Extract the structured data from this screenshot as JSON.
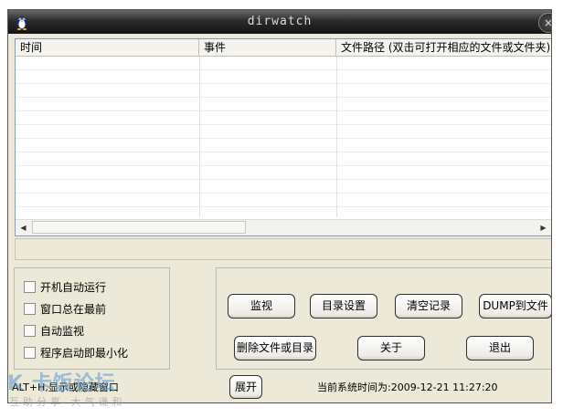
{
  "window": {
    "title": "dirwatch",
    "close_glyph": "×"
  },
  "list": {
    "columns": [
      "时间",
      "事件",
      "文件路径 (双击可打开相应的文件或文件夹)"
    ]
  },
  "options": {
    "auto_start": "开机自动运行",
    "always_on_top": "窗口总在最前",
    "auto_monitor": "自动监视",
    "minimize_on_start": "程序启动即最小化"
  },
  "buttons": {
    "monitor": "监视",
    "dir_settings": "目录设置",
    "clear_log": "清空记录",
    "dump_to_file": "DUMP到文件",
    "delete": "删除文件或目录",
    "about": "关于",
    "exit": "退出",
    "expand": "展开"
  },
  "status": {
    "hotkey_hint": "ALT+H,显示或隐藏窗口",
    "current_time": "当前系统时间为:2009-12-21 11:27:20"
  },
  "watermark": {
    "logo": "K 卡饭论坛",
    "sub": "互助分享 大气谦和"
  },
  "icons": {
    "app": "penguin-icon",
    "close": "close-icon",
    "scroll_left": "arrow-left-icon",
    "scroll_right": "arrow-right-icon"
  }
}
